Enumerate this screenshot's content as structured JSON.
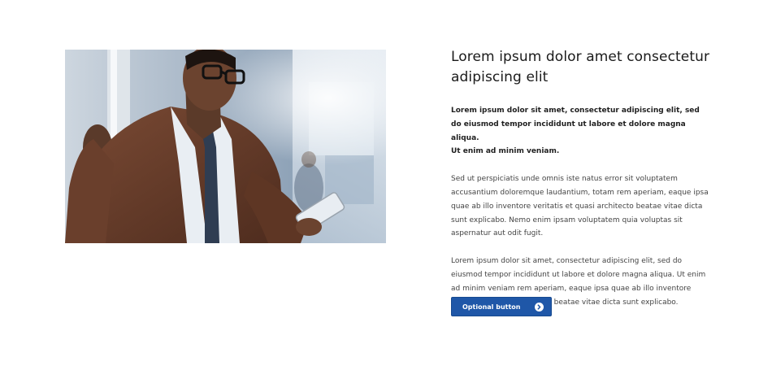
{
  "hero": {
    "image_icon": "commuter-photo"
  },
  "content": {
    "title": "Lorem ipsum dolor amet consectetur adipiscing elit",
    "lead_lines": [
      "Lorem ipsum dolor sit amet, consectetur adipiscing elit, sed do eiusmod tempor incididunt ut labore et dolore magna aliqua.",
      "Ut enim ad minim veniam."
    ],
    "paragraph_1": "Sed ut perspiciatis unde omnis iste natus error sit voluptatem accusantium doloremque laudantium, totam rem aperiam, eaque ipsa quae ab illo inventore veritatis et quasi architecto beatae vitae dicta sunt explicabo. Nemo enim ipsam voluptatem quia voluptas sit aspernatur aut odit fugit.",
    "paragraph_2": "Lorem ipsum dolor sit amet, consectetur adipiscing elit, sed do eiusmod tempor incididunt ut labore et dolore magna aliqua. Ut enim ad minim veniam rem aperiam, eaque ipsa quae ab illo inventore veritatis et quasi architecto beatae vitae dicta sunt explicabo."
  },
  "button": {
    "label": "Optional button",
    "icon": "chevron-right-circle-icon"
  },
  "colors": {
    "button_bg": "#1f57a8",
    "title_text": "#1a1a1a",
    "body_text": "#444444"
  }
}
